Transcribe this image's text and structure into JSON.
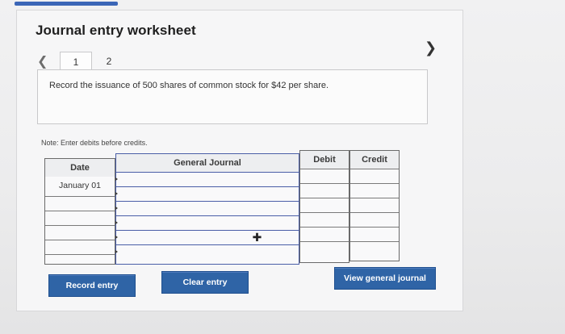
{
  "worksheet": {
    "title": "Journal entry worksheet",
    "tabs": [
      {
        "label": "1",
        "active": true
      },
      {
        "label": "2",
        "active": false
      }
    ],
    "instruction": "Record the issuance of 500 shares of common stock for $42 per share.",
    "note": "Note: Enter debits before credits."
  },
  "journal": {
    "headers": {
      "date": "Date",
      "general_journal": "General Journal",
      "debit": "Debit",
      "credit": "Credit"
    },
    "rows": [
      {
        "date": "January 01",
        "account": "",
        "debit": "",
        "credit": ""
      },
      {
        "date": "",
        "account": "",
        "debit": "",
        "credit": ""
      },
      {
        "date": "",
        "account": "",
        "debit": "",
        "credit": ""
      },
      {
        "date": "",
        "account": "",
        "debit": "",
        "credit": ""
      },
      {
        "date": "",
        "account": "",
        "debit": "",
        "credit": ""
      },
      {
        "date": "",
        "account": "",
        "debit": "",
        "credit": ""
      }
    ]
  },
  "buttons": {
    "record": "Record entry",
    "clear": "Clear entry",
    "view": "View general journal"
  },
  "icons": {
    "prev": "chevron-left-icon",
    "next": "chevron-right-icon",
    "cursor": "move-cursor-icon"
  },
  "colors": {
    "button_bg": "#2f64a6",
    "progress": "#3b66b7"
  }
}
